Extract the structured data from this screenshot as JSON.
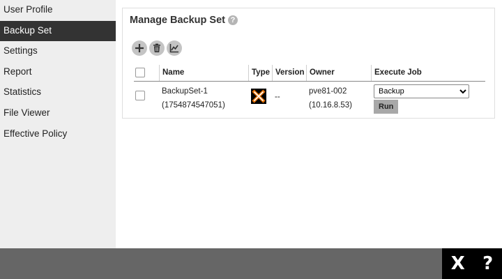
{
  "sidebar": {
    "items": [
      {
        "label": "User Profile"
      },
      {
        "label": "Backup Set",
        "active": true
      },
      {
        "label": "Settings"
      },
      {
        "label": "Report"
      },
      {
        "label": "Statistics"
      },
      {
        "label": "File Viewer"
      },
      {
        "label": "Effective Policy"
      }
    ]
  },
  "panel": {
    "title": "Manage Backup Set",
    "help_glyph": "?",
    "toolbar": [
      "add-icon",
      "trash-icon",
      "chart-icon"
    ]
  },
  "table": {
    "headers": {
      "name": "Name",
      "type": "Type",
      "version": "Version",
      "owner": "Owner",
      "execute": "Execute Job"
    },
    "rows": [
      {
        "name": "BackupSet-1",
        "id": "(1754874547051)",
        "type_icon": "proxmox-icon",
        "version": "--",
        "owner": "pve81-002",
        "owner_ip": "(10.16.8.53)",
        "execute_selected": "Backup",
        "run_label": "Run"
      }
    ]
  },
  "footer": {
    "close_glyph": "X",
    "help_glyph": "?"
  },
  "colors": {
    "sidebar_bg": "#eeeeee",
    "sidebar_active_bg": "#333333",
    "footer_bg": "#666666",
    "proxmox_orange": "#e57000"
  }
}
